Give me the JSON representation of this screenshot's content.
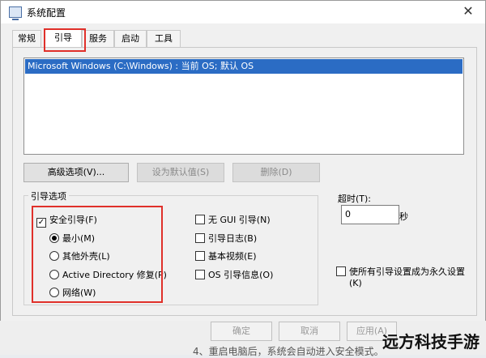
{
  "window": {
    "title": "系统配置",
    "close_glyph": "✕"
  },
  "tabs": [
    {
      "label": "常规"
    },
    {
      "label": "引导"
    },
    {
      "label": "服务"
    },
    {
      "label": "启动"
    },
    {
      "label": "工具"
    }
  ],
  "os_list": {
    "selected_entry": "Microsoft Windows (C:\\Windows) : 当前 OS; 默认 OS"
  },
  "buttons": {
    "advanced": "高级选项(V)...",
    "set_default": "设为默认值(S)",
    "delete": "删除(D)"
  },
  "boot_options": {
    "label": "引导选项",
    "safe_boot": {
      "label": "安全引导(F)",
      "checked": true
    },
    "radios": [
      {
        "label": "最小(M)",
        "selected": true
      },
      {
        "label": "其他外壳(L)",
        "selected": false
      },
      {
        "label": "Active Directory 修复(P)",
        "selected": false
      },
      {
        "label": "网络(W)",
        "selected": false
      }
    ],
    "right_checks": [
      {
        "label": "无 GUI 引导(N)",
        "checked": false
      },
      {
        "label": "引导日志(B)",
        "checked": false
      },
      {
        "label": "基本视频(E)",
        "checked": false
      },
      {
        "label": "OS 引导信息(O)",
        "checked": false
      }
    ]
  },
  "timeout": {
    "label": "超时(T):",
    "value": "0",
    "unit": "秒"
  },
  "permanent": {
    "label_line1": "使所有引导设置成为永久设置",
    "label_line2": "(K)",
    "checked": false
  },
  "footer": {
    "ok": "确定",
    "cancel": "取消",
    "apply": "应用(A)"
  },
  "watermark": {
    "text": "远方科技手游",
    "bg_text": "4、重启电脑后，系统会自动进入安全模式。"
  },
  "colors": {
    "accent_highlight": "#e0302a",
    "selection": "#2b6cc4"
  }
}
